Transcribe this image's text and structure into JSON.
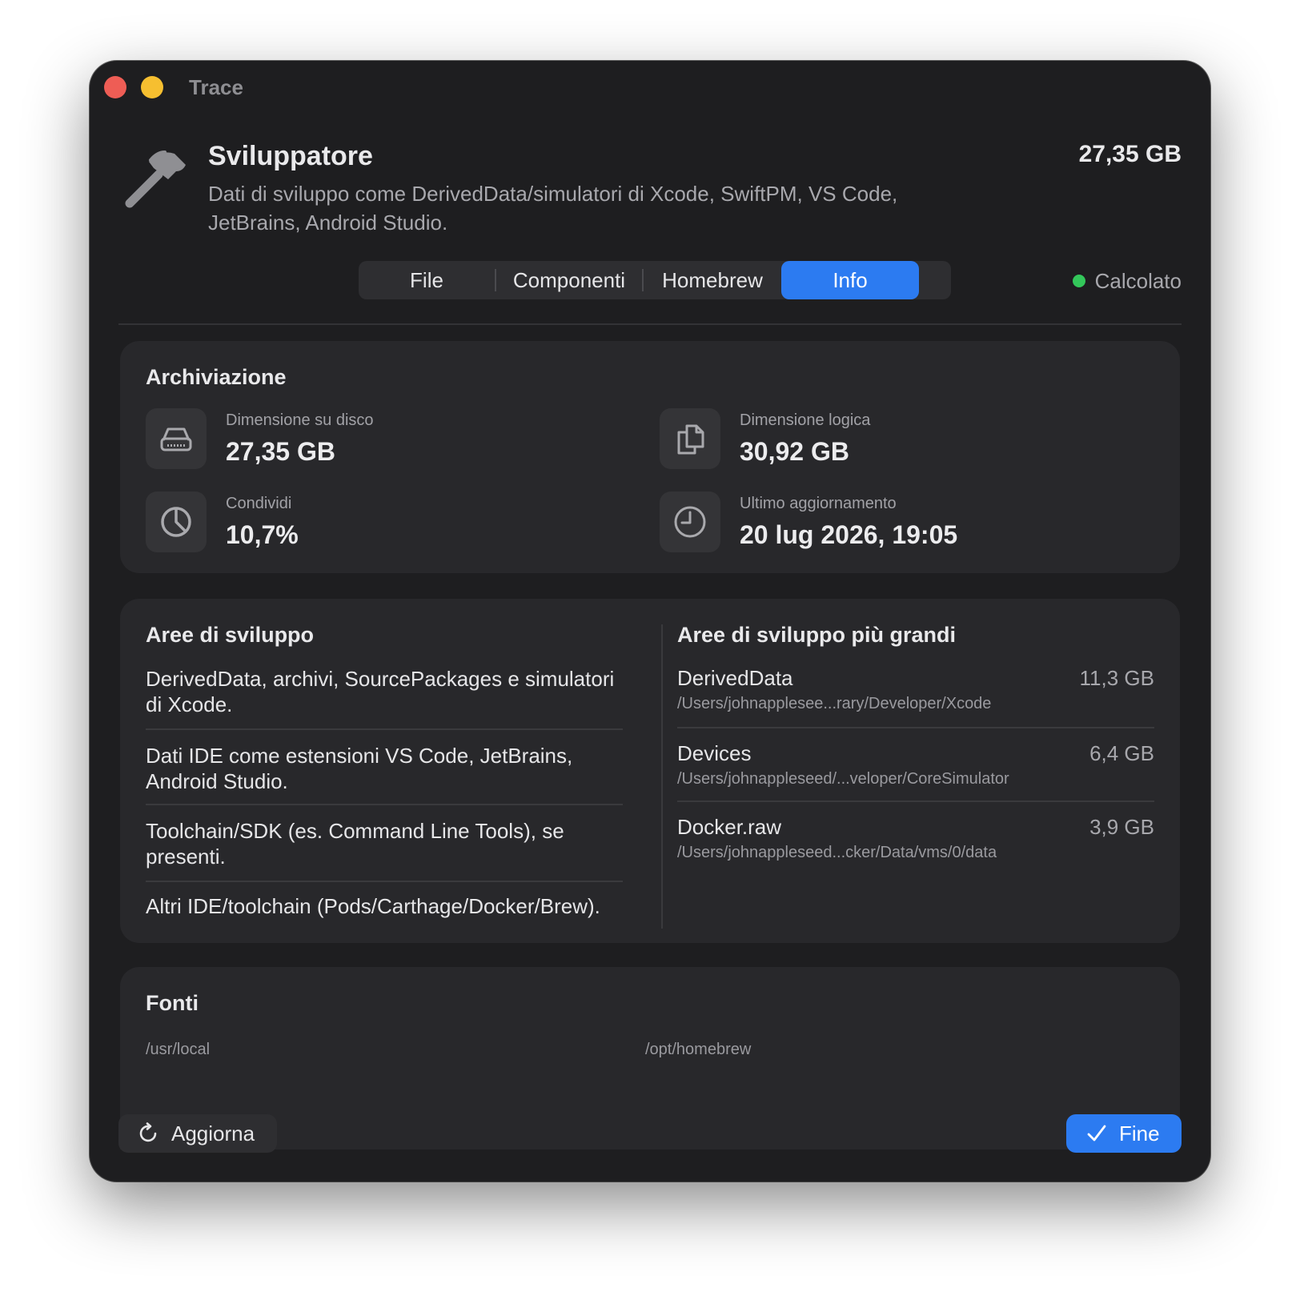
{
  "window": {
    "title": "Trace"
  },
  "header": {
    "icon": "hammer-icon",
    "title": "Sviluppatore",
    "description": "Dati di sviluppo come DerivedData/simulatori di Xcode, SwiftPM, VS Code, JetBrains, Android Studio.",
    "size": "27,35 GB"
  },
  "tabs": [
    {
      "label": "File",
      "active": false
    },
    {
      "label": "Componenti",
      "active": false
    },
    {
      "label": "Homebrew",
      "active": false
    },
    {
      "label": "Info",
      "active": true
    }
  ],
  "status": {
    "label": "Calcolato",
    "color": "#33c75a"
  },
  "storage": {
    "title": "Archiviazione",
    "stats": [
      {
        "label": "Dimensione su disco",
        "value": "27,35 GB",
        "icon": "hard-drive-icon"
      },
      {
        "label": "Dimensione logica",
        "value": "30,92 GB",
        "icon": "documents-icon"
      },
      {
        "label": "Condividi",
        "value": "10,7%",
        "icon": "pie-chart-icon"
      },
      {
        "label": "Ultimo aggiornamento",
        "value": "20 lug 2026, 19:05",
        "icon": "clock-icon"
      }
    ]
  },
  "areas": {
    "title": "Aree di sviluppo",
    "items": [
      "DerivedData, archivi, SourcePackages e simulatori di Xcode.",
      "Dati IDE come estensioni VS Code, JetBrains, Android Studio.",
      "Toolchain/SDK (es. Command Line Tools), se presenti.",
      "Altri IDE/toolchain (Pods/Carthage/Docker/Brew)."
    ]
  },
  "largest": {
    "title": "Aree di sviluppo più grandi",
    "items": [
      {
        "name": "DerivedData",
        "path": "/Users/johnapplesee...rary/Developer/Xcode",
        "size": "11,3 GB"
      },
      {
        "name": "Devices",
        "path": "/Users/johnappleseed/...veloper/CoreSimulator",
        "size": "6,4 GB"
      },
      {
        "name": "Docker.raw",
        "path": "/Users/johnappleseed...cker/Data/vms/0/data",
        "size": "3,9 GB"
      }
    ]
  },
  "sources": {
    "title": "Fonti",
    "items": [
      "/usr/local",
      "/opt/homebrew"
    ]
  },
  "footer": {
    "refresh_label": "Aggiorna",
    "done_label": "Fine"
  },
  "colors": {
    "accent": "#2c7bf1",
    "close": "#ee5d55",
    "minimize": "#f6bf30"
  }
}
